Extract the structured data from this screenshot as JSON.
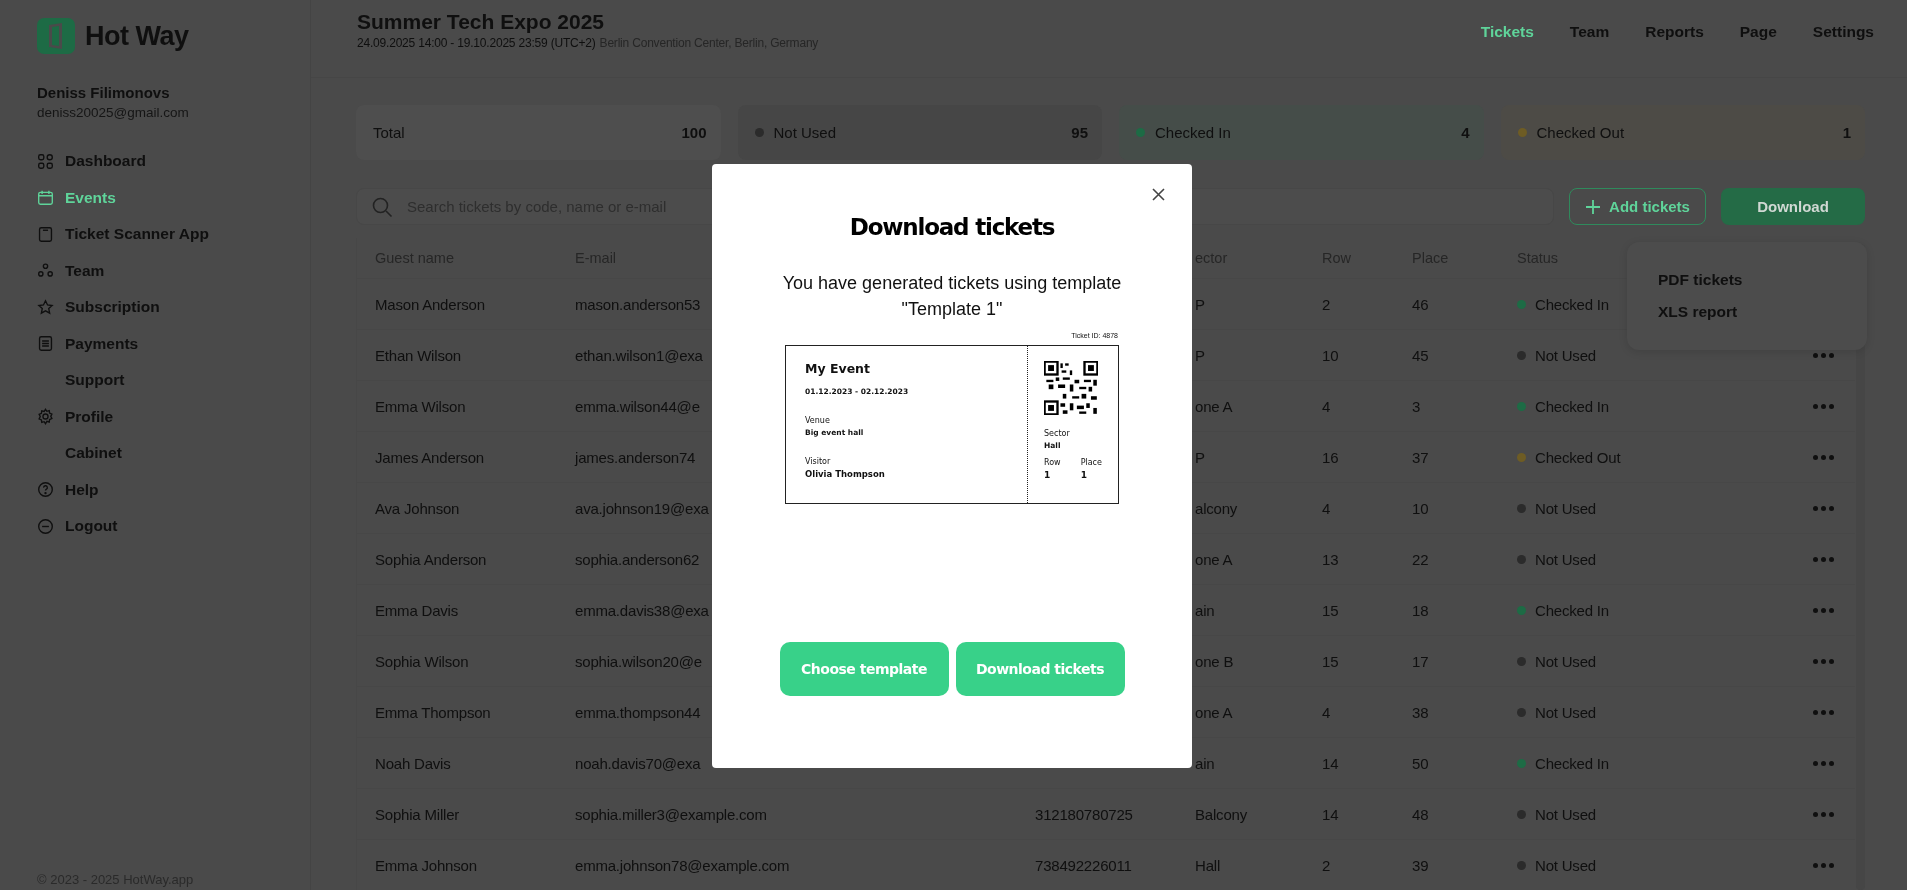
{
  "brand": {
    "name": "Hot Way"
  },
  "user": {
    "name": "Deniss Filimonovs",
    "email": "deniss20025@gmail.com"
  },
  "sidebar": {
    "items": [
      {
        "label": "Dashboard",
        "kind": "with_icon",
        "selected": false
      },
      {
        "label": "Events",
        "kind": "with_icon",
        "selected": true
      },
      {
        "label": "Ticket Scanner App",
        "kind": "with_icon",
        "selected": false
      },
      {
        "label": "Team",
        "kind": "with_icon",
        "selected": false
      },
      {
        "label": "Subscription",
        "kind": "with_icon",
        "selected": false
      },
      {
        "label": "Payments",
        "kind": "with_icon",
        "selected": false
      },
      {
        "label": "Support",
        "kind": "text",
        "selected": false
      },
      {
        "label": "Profile",
        "kind": "with_icon",
        "selected": false
      },
      {
        "label": "Cabinet",
        "kind": "text",
        "selected": false
      },
      {
        "label": "Help",
        "kind": "with_icon",
        "selected": false
      },
      {
        "label": "Logout",
        "kind": "with_icon",
        "selected": false
      }
    ],
    "footer": "© 2023 - 2025 HotWay.app"
  },
  "event": {
    "title": "Summer Tech Expo 2025",
    "dates": "24.09.2025 14:00 - 19.10.2025 23:59 (UTC+2)",
    "venue": "Berlin Convention Center, Berlin, Germany"
  },
  "tabs": [
    {
      "label": "Tickets",
      "selected": true
    },
    {
      "label": "Team",
      "selected": false
    },
    {
      "label": "Reports",
      "selected": false
    },
    {
      "label": "Page",
      "selected": false
    },
    {
      "label": "Settings",
      "selected": false
    }
  ],
  "stats": [
    {
      "kind": "total",
      "label": "Total",
      "value": "100"
    },
    {
      "kind": "status",
      "label": "Not Used",
      "value": "95",
      "color": "#2b2b2b"
    },
    {
      "kind": "status",
      "label": "Checked In",
      "value": "4",
      "color": "#1d6b45"
    },
    {
      "kind": "status",
      "label": "Checked Out",
      "value": "1",
      "color": "#6e5c24"
    }
  ],
  "search": {
    "placeholder": "Search tickets by code, name or e-mail"
  },
  "buttons": {
    "add": "Add tickets",
    "download": "Download"
  },
  "download_menu": {
    "items": [
      "PDF tickets",
      "XLS report"
    ]
  },
  "table": {
    "columns": {
      "guest_name": "Guest name",
      "email": "E-mail",
      "sector": "ector",
      "row": "Row",
      "place": "Place",
      "status": "Status"
    },
    "rows": [
      {
        "guest_name": "Mason Anderson",
        "email": "mason.anderson53",
        "sector": "P",
        "row": "2",
        "place": "46",
        "status": "Checked In",
        "color": "#1d6b45",
        "more_button": false
      },
      {
        "guest_name": "Ethan Wilson",
        "email": "ethan.wilson1@exa",
        "sector": "P",
        "row": "10",
        "place": "45",
        "status": "Not Used",
        "color": "#2b2b2b",
        "more_button": true
      },
      {
        "guest_name": "Emma Wilson",
        "email": "emma.wilson44@e",
        "sector": "one A",
        "row": "4",
        "place": "3",
        "status": "Checked In",
        "color": "#1d6b45",
        "more_button": true
      },
      {
        "guest_name": "James Anderson",
        "email": "james.anderson74",
        "sector": "P",
        "row": "16",
        "place": "37",
        "status": "Checked Out",
        "color": "#6e5c24",
        "more_button": true
      },
      {
        "guest_name": "Ava Johnson",
        "email": "ava.johnson19@exa",
        "sector": "alcony",
        "row": "4",
        "place": "10",
        "status": "Not Used",
        "color": "#2b2b2b",
        "more_button": true
      },
      {
        "guest_name": "Sophia Anderson",
        "email": "sophia.anderson62",
        "sector": "one A",
        "row": "13",
        "place": "22",
        "status": "Not Used",
        "color": "#2b2b2b",
        "more_button": true
      },
      {
        "guest_name": "Emma Davis",
        "email": "emma.davis38@exa",
        "sector": "ain",
        "row": "15",
        "place": "18",
        "status": "Checked In",
        "color": "#1d6b45",
        "more_button": true
      },
      {
        "guest_name": "Sophia Wilson",
        "email": "sophia.wilson20@e",
        "sector": "one B",
        "row": "15",
        "place": "17",
        "status": "Not Used",
        "color": "#2b2b2b",
        "more_button": true
      },
      {
        "guest_name": "Emma Thompson",
        "email": "emma.thompson44",
        "sector": "one A",
        "row": "4",
        "place": "38",
        "status": "Not Used",
        "color": "#2b2b2b",
        "more_button": true
      },
      {
        "guest_name": "Noah Davis",
        "email": "noah.davis70@exa",
        "sector": "ain",
        "row": "14",
        "place": "50",
        "status": "Checked In",
        "color": "#1d6b45",
        "more_button": true
      },
      {
        "guest_name": "Sophia Miller",
        "email": "sophia.miller3@example.com",
        "ticket_code": "312180780725",
        "sector": "Balcony",
        "row": "14",
        "place": "48",
        "status": "Not Used",
        "color": "#2b2b2b",
        "more_button": true
      },
      {
        "guest_name": "Emma Johnson",
        "email": "emma.johnson78@example.com",
        "ticket_code": "738492226011",
        "sector": "Hall",
        "row": "2",
        "place": "39",
        "status": "Not Used",
        "color": "#2b2b2b",
        "more_button": true
      }
    ]
  },
  "modal": {
    "title": "Download tickets",
    "message": "You have generated tickets using template \"Template 1\"",
    "ticket": {
      "ticket_id": "Ticket ID: 4878",
      "event": "My Event",
      "dates": "01.12.2023 - 02.12.2023",
      "venue_label": "Venue",
      "venue": "Big event hall",
      "visitor_label": "Visitor",
      "visitor": "Olivia Thompson",
      "sector_label": "Sector",
      "sector": "Hall",
      "row_label": "Row",
      "row": "1",
      "place_label": "Place",
      "place": "1"
    },
    "buttons": [
      "Choose template",
      "Download tickets"
    ]
  }
}
